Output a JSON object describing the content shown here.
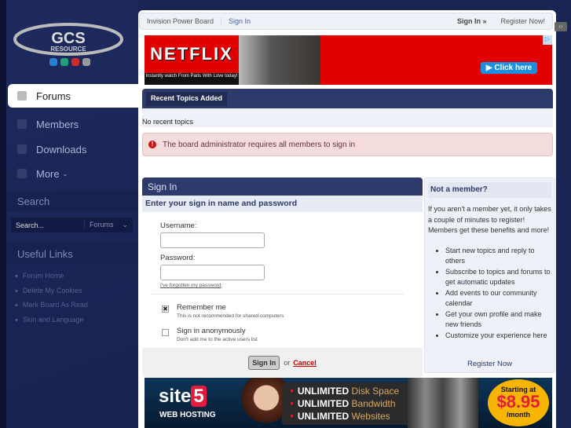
{
  "logo": {
    "text_line1": "GCS",
    "text_line2": "RESOURCE"
  },
  "sidebar": {
    "nav": [
      {
        "label": "Forums",
        "icon": "speech-bubble-icon"
      },
      {
        "label": "Members",
        "icon": "user-icon"
      },
      {
        "label": "Downloads",
        "icon": "download-icon"
      },
      {
        "label": "More",
        "icon": "plus-icon"
      }
    ],
    "search_title": "Search",
    "search_placeholder": "Search...",
    "search_scope": "Forums",
    "links_title": "Useful Links",
    "links": [
      "Forum Home",
      "Delete My Cookies",
      "Mark Board As Read",
      "Skin and Language"
    ]
  },
  "breadcrumb": {
    "items": [
      "Invision Power Board",
      "Sign In"
    ],
    "sign_in": "Sign In »",
    "register": "Register Now!"
  },
  "ad_top": {
    "brand": "NETFLIX",
    "caption": "Instantly watch From Paris With Love today!",
    "button": "Click here"
  },
  "recent": {
    "title": "Recent Topics Added",
    "empty": "No recent topics"
  },
  "error": {
    "message": "The board administrator requires all members to sign in"
  },
  "signin": {
    "title": "Sign In",
    "subtitle": "Enter your sign in name and password",
    "username_label": "Username:",
    "password_label": "Password:",
    "username_value": "",
    "password_value": "",
    "forgot": "I've forgotten my password",
    "remember_label": "Remember me",
    "remember_desc": "This is not recommended for shared computers",
    "remember_checked": true,
    "anon_label": "Sign in anonymously",
    "anon_desc": "Don't add me to the active users list",
    "anon_checked": false,
    "submit": "Sign In",
    "or": "or",
    "cancel": "Cancel"
  },
  "not_member": {
    "title": "Not a member?",
    "intro": "If you aren't a member yet, it only takes a couple of minutes to register! Members get these benefits and more!",
    "benefits": [
      "Start new topics and reply to others",
      "Subscribe to topics and forums to get automatic updates",
      "Add events to our community calendar",
      "Get your own profile and make new friends",
      "Customize your experience here"
    ],
    "register": "Register Now"
  },
  "ad_bottom": {
    "brand": "site",
    "brand_num": "5",
    "tagline": "WEB HOSTING",
    "lines": [
      {
        "bold": "UNLIMITED",
        "rest": "Disk Space"
      },
      {
        "bold": "UNLIMITED",
        "rest": "Bandwidth"
      },
      {
        "bold": "UNLIMITED",
        "rest": "Websites"
      }
    ],
    "price_top": "Starting at",
    "price": "$8.95",
    "price_unit": "/month"
  },
  "colors": {
    "navy": "#2c3a6c",
    "background": "#1b2553",
    "error_bg": "#f4dcdc"
  }
}
